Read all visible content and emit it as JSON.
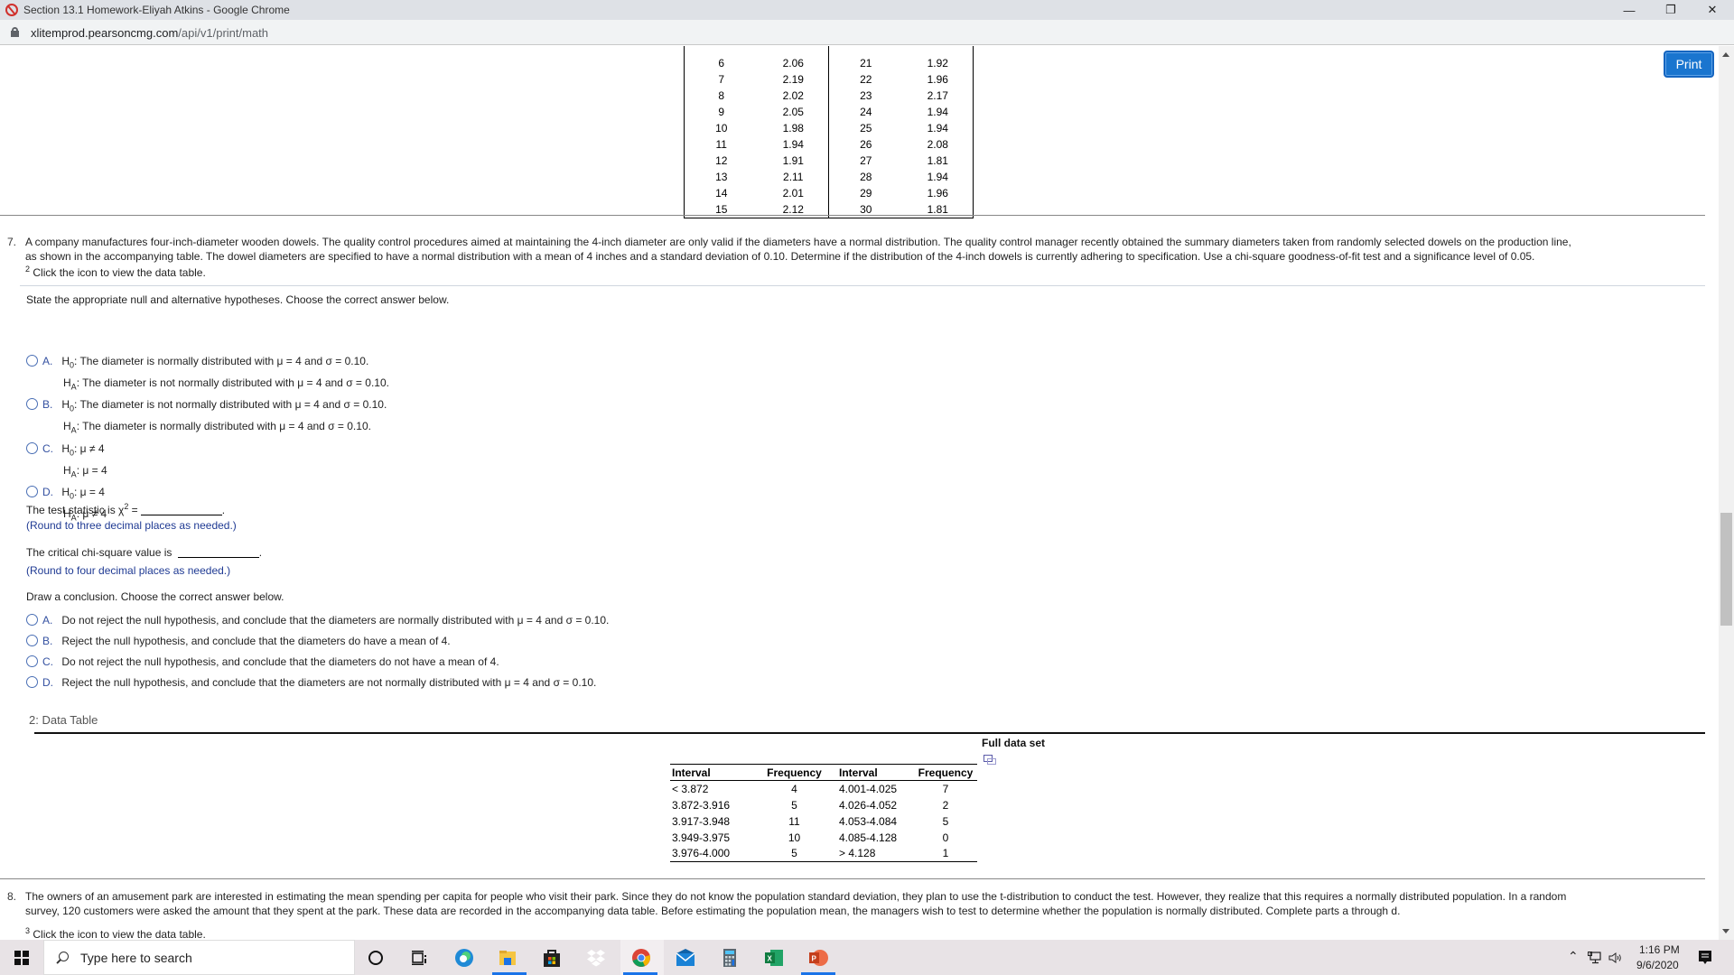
{
  "window": {
    "title": "Section 13.1 Homework-Eliyah Atkins - Google Chrome",
    "controls": {
      "minimize": "—",
      "restore": "❐",
      "close": "✕"
    }
  },
  "address_bar": {
    "host": "xlitemprod.pearsoncmg.com",
    "path": "/api/v1/print/math"
  },
  "toolbar": {
    "print_label": "Print"
  },
  "top_table": {
    "rows": [
      {
        "n1": "6",
        "v1": "2.06",
        "n2": "21",
        "v2": "1.92"
      },
      {
        "n1": "7",
        "v1": "2.19",
        "n2": "22",
        "v2": "1.96"
      },
      {
        "n1": "8",
        "v1": "2.02",
        "n2": "23",
        "v2": "2.17"
      },
      {
        "n1": "9",
        "v1": "2.05",
        "n2": "24",
        "v2": "1.94"
      },
      {
        "n1": "10",
        "v1": "1.98",
        "n2": "25",
        "v2": "1.94"
      },
      {
        "n1": "11",
        "v1": "1.94",
        "n2": "26",
        "v2": "2.08"
      },
      {
        "n1": "12",
        "v1": "1.91",
        "n2": "27",
        "v2": "1.81"
      },
      {
        "n1": "13",
        "v1": "2.11",
        "n2": "28",
        "v2": "1.94"
      },
      {
        "n1": "14",
        "v1": "2.01",
        "n2": "29",
        "v2": "1.96"
      },
      {
        "n1": "15",
        "v1": "2.12",
        "n2": "30",
        "v2": "1.81"
      }
    ]
  },
  "question7": {
    "number": "7.",
    "text_line1": "A company manufactures four-inch-diameter wooden dowels. The quality control procedures aimed at maintaining the 4-inch diameter are only valid if the diameters have a normal distribution. The quality control manager recently obtained the summary diameters taken from randomly selected dowels on the production line,",
    "text_line2": "as shown in the accompanying table. The dowel diameters are specified to have a normal distribution with a mean of 4 inches and a standard deviation of 0.10. Determine if the distribution of the 4-inch dowels is currently adhering to specification. Use a chi-square goodness-of-fit test and a significance level of 0.05.",
    "footnote_num": "2",
    "footnote_text": "Click the icon to view the data table.",
    "hypotheses_prompt": "State the appropriate null and alternative hypotheses. Choose the correct answer below.",
    "hypotheses_options": [
      {
        "letter": "A.",
        "h0": ": The diameter is normally distributed with μ = 4 and σ = 0.10.",
        "ha": ": The diameter is not normally distributed with μ = 4 and σ = 0.10."
      },
      {
        "letter": "B.",
        "h0": ": The diameter is not normally distributed with μ = 4 and σ = 0.10.",
        "ha": ": The diameter is normally distributed with μ = 4 and σ = 0.10."
      },
      {
        "letter": "C.",
        "h0": ": μ ≠ 4",
        "ha": ": μ = 4"
      },
      {
        "letter": "D.",
        "h0": ": μ = 4",
        "ha": ": μ ≠ 4"
      }
    ],
    "test_stat_label": "The test statistic is χ",
    "test_stat_sup": "2",
    "test_stat_eq": " =",
    "test_stat_value": "",
    "test_stat_note": "(Round to three decimal places as needed.)",
    "critical_label": "The critical chi-square value is",
    "critical_value": "",
    "critical_note": "(Round to four decimal places as needed.)",
    "conclusion_prompt": "Draw a conclusion. Choose the correct answer below.",
    "conclusion_options": [
      {
        "letter": "A.",
        "text": "Do not reject the null hypothesis, and conclude that the diameters are normally distributed with μ = 4 and σ = 0.10."
      },
      {
        "letter": "B.",
        "text": "Reject the null hypothesis, and conclude that the diameters do have a mean of 4."
      },
      {
        "letter": "C.",
        "text": "Do not reject the null hypothesis, and conclude that the diameters do not have a mean of 4."
      },
      {
        "letter": "D.",
        "text": "Reject the null hypothesis, and conclude that the diameters are not normally distributed with μ = 4 and σ = 0.10."
      }
    ]
  },
  "data_table": {
    "label": "2: Data Table",
    "full_data_set": "Full data set",
    "headers": [
      "Interval",
      "Frequency",
      "Interval",
      "Frequency"
    ],
    "rows": [
      {
        "i1": "< 3.872",
        "f1": "4",
        "i2": "4.001-4.025",
        "f2": "7"
      },
      {
        "i1": "3.872-3.916",
        "f1": "5",
        "i2": "4.026-4.052",
        "f2": "2"
      },
      {
        "i1": "3.917-3.948",
        "f1": "11",
        "i2": "4.053-4.084",
        "f2": "5"
      },
      {
        "i1": "3.949-3.975",
        "f1": "10",
        "i2": "4.085-4.128",
        "f2": "0"
      },
      {
        "i1": "3.976-4.000",
        "f1": "5",
        "i2": "> 4.128",
        "f2": "1"
      }
    ]
  },
  "question8": {
    "number": "8.",
    "text_line1": "The owners of an amusement park are interested in estimating the mean spending per capita for people who visit their park. Since they do not know the population standard deviation, they plan to use the t-distribution to conduct the test. However, they realize that this requires a normally distributed population. In a random",
    "text_line2": "survey, 120 customers were asked the amount that they spent at the park. These data are recorded in the accompanying data table. Before estimating the population mean, the managers wish to test to determine whether the population is normally distributed. Complete parts a through d.",
    "footnote_num": "3",
    "footnote_text": "Click the icon to view the data table."
  },
  "taskbar": {
    "search_placeholder": "Type here to search",
    "time": "1:16 PM",
    "date": "9/6/2020",
    "apps": [
      "cortana-icon",
      "task-view-icon",
      "edge-icon",
      "file-explorer-icon",
      "store-icon",
      "dropbox-icon",
      "chrome-icon",
      "mail-icon",
      "calculator-icon",
      "excel-icon",
      "powerpoint-icon"
    ]
  }
}
